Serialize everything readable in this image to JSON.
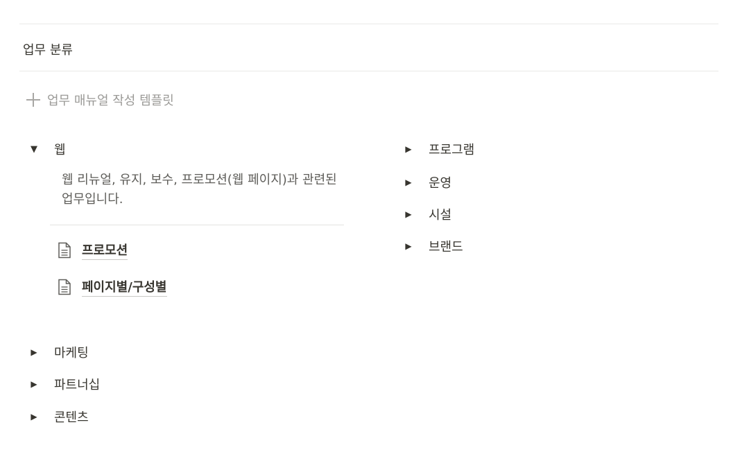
{
  "section": {
    "heading": "업무 분류",
    "new_template_label": "업무 매뉴얼 작성 템플릿"
  },
  "left_column": {
    "open_toggle": {
      "title": "웹",
      "description": "웹 리뉴얼, 유지, 보수, 프로모션(웹 페이지)과 관련된 업무입니다.",
      "pages": [
        {
          "label": "프로모션",
          "icon": "document-icon"
        },
        {
          "label": "페이지별/구성별",
          "icon": "document-icon"
        }
      ]
    },
    "toggles": [
      {
        "title": "마케팅"
      },
      {
        "title": "파트너십"
      },
      {
        "title": "콘텐츠"
      }
    ]
  },
  "right_column": {
    "toggles": [
      {
        "title": "프로그램"
      },
      {
        "title": "운영"
      },
      {
        "title": "시설"
      },
      {
        "title": "브랜드"
      }
    ]
  },
  "icons": {
    "expanded_arrow": "▼",
    "collapsed_arrow": "▶"
  }
}
